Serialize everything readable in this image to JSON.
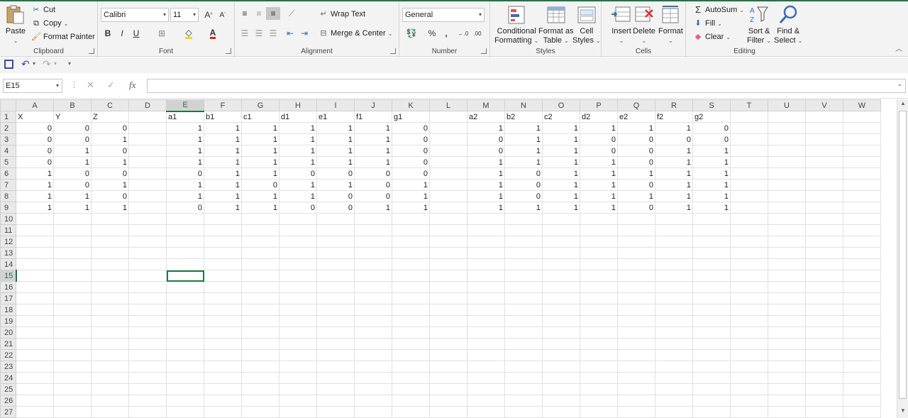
{
  "ribbon": {
    "clipboard": {
      "label": "Clipboard",
      "paste": "Paste",
      "cut": "Cut",
      "copy": "Copy",
      "format_painter": "Format Painter"
    },
    "font": {
      "label": "Font",
      "font_name": "Calibri",
      "font_size": "11",
      "bold": "B",
      "italic": "I",
      "underline": "U",
      "grow": "A",
      "shrink": "A"
    },
    "alignment": {
      "label": "Alignment",
      "wrap_text": "Wrap Text",
      "merge_center": "Merge & Center"
    },
    "number": {
      "label": "Number",
      "format": "General",
      "percent": "%",
      "comma": ","
    },
    "styles": {
      "label": "Styles",
      "conditional_1": "Conditional",
      "conditional_2": "Formatting",
      "format_as_1": "Format as",
      "format_as_2": "Table",
      "cell_styles_1": "Cell",
      "cell_styles_2": "Styles"
    },
    "cells": {
      "label": "Cells",
      "insert": "Insert",
      "delete": "Delete",
      "format": "Format"
    },
    "editing": {
      "label": "Editing",
      "autosum": "AutoSum",
      "fill": "Fill",
      "clear": "Clear",
      "sort_1": "Sort &",
      "sort_2": "Filter",
      "find_1": "Find &",
      "find_2": "Select"
    }
  },
  "formula_bar": {
    "name_box": "E15",
    "fx": "fx",
    "value": ""
  },
  "sheet": {
    "columns": [
      "A",
      "B",
      "C",
      "D",
      "E",
      "F",
      "G",
      "H",
      "I",
      "J",
      "K",
      "L",
      "M",
      "N",
      "O",
      "P",
      "Q",
      "R",
      "S",
      "T",
      "U",
      "V",
      "W"
    ],
    "column_widths": [
      53,
      53,
      53,
      53,
      53,
      53,
      53,
      53,
      53,
      53,
      53,
      53,
      53,
      53,
      53,
      53,
      53,
      53,
      53,
      53,
      53,
      53,
      53
    ],
    "header_row": [
      "X",
      "Y",
      "Z",
      "",
      "a1",
      "b1",
      "c1",
      "d1",
      "e1",
      "f1",
      "g1",
      "",
      "a2",
      "b2",
      "c2",
      "d2",
      "e2",
      "f2",
      "g2",
      "",
      "",
      "",
      ""
    ],
    "rows": [
      [
        0,
        0,
        0,
        "",
        1,
        1,
        1,
        1,
        1,
        1,
        0,
        "",
        1,
        1,
        1,
        1,
        1,
        1,
        0,
        "",
        "",
        "",
        ""
      ],
      [
        0,
        0,
        1,
        "",
        1,
        1,
        1,
        1,
        1,
        1,
        0,
        "",
        0,
        1,
        1,
        0,
        0,
        0,
        0,
        "",
        "",
        "",
        ""
      ],
      [
        0,
        1,
        0,
        "",
        1,
        1,
        1,
        1,
        1,
        1,
        0,
        "",
        0,
        1,
        1,
        0,
        0,
        1,
        1,
        "",
        "",
        "",
        ""
      ],
      [
        0,
        1,
        1,
        "",
        1,
        1,
        1,
        1,
        1,
        1,
        0,
        "",
        1,
        1,
        1,
        1,
        0,
        1,
        1,
        "",
        "",
        "",
        ""
      ],
      [
        1,
        0,
        0,
        "",
        0,
        1,
        1,
        0,
        0,
        0,
        0,
        "",
        1,
        0,
        1,
        1,
        1,
        1,
        1,
        "",
        "",
        "",
        ""
      ],
      [
        1,
        0,
        1,
        "",
        1,
        1,
        0,
        1,
        1,
        0,
        1,
        "",
        1,
        0,
        1,
        1,
        0,
        1,
        1,
        "",
        "",
        "",
        ""
      ],
      [
        1,
        1,
        0,
        "",
        1,
        1,
        1,
        1,
        0,
        0,
        1,
        "",
        1,
        0,
        1,
        1,
        1,
        1,
        1,
        "",
        "",
        "",
        ""
      ],
      [
        1,
        1,
        1,
        "",
        0,
        1,
        1,
        0,
        0,
        1,
        1,
        "",
        1,
        1,
        1,
        1,
        0,
        1,
        1,
        "",
        "",
        "",
        ""
      ]
    ],
    "total_rows": 27,
    "active_cell": {
      "col": "E",
      "row": 15
    }
  }
}
